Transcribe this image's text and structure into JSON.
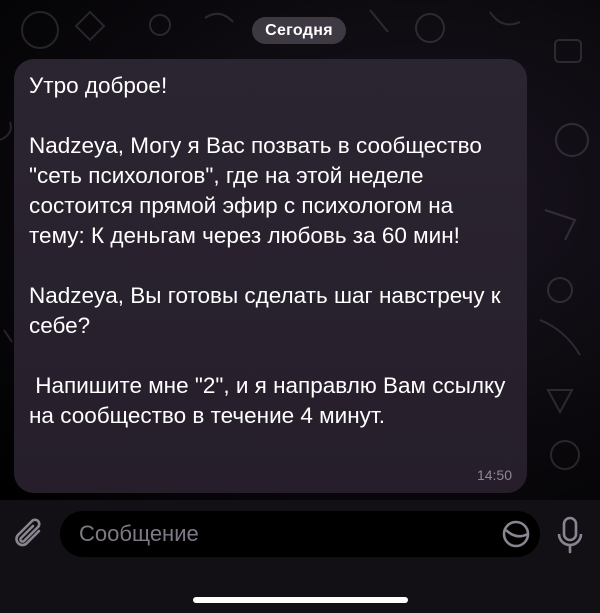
{
  "date_separator": "Сегодня",
  "message": {
    "text": "Утро доброе!\n\nNadzeya, Могу я Вас позвать в сообщество \"сеть психологов\", где на этой неделе состоится прямой эфир с психологом на тему: К деньгам через любовь за 60 мин!\n\nNadzeya, Вы готовы сделать шаг навстречу к себе?\n\n Напишите мне \"2\", и я направлю Вам ссылку на сообщество в течение 4 минут.",
    "time": "14:50"
  },
  "composer": {
    "placeholder": "Сообщение",
    "icons": [
      "paperclip-icon",
      "sticker-icon",
      "microphone-icon"
    ]
  },
  "colors": {
    "bubble": "#2b2531",
    "date_pill": "#46424c",
    "time_text": "#8d8794",
    "placeholder": "#7e7984"
  }
}
